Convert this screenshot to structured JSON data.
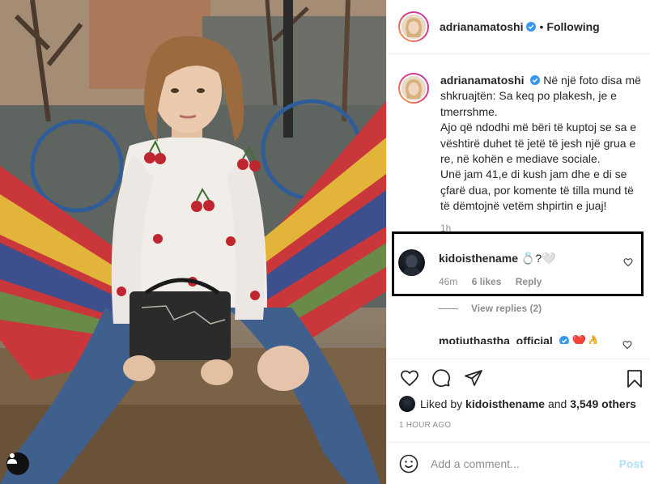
{
  "post": {
    "username": "adrianamatoshi",
    "separator": "•",
    "follow_status": "Following",
    "caption_text": "Në një foto disa më shkruajtën: Sa keq po plakesh, je e tmerrshme.\nAjo që ndodhi më bëri të kuptoj se sa e vështirë duhet të jetë të jesh një grua e re, në kohën e mediave sociale.\nUnë jam 41,e di kush jam dhe e di se çfarë dua, por komente të tilla mund të të dëmtojnë vetëm shpirtin e juaj!",
    "caption_age": "1h"
  },
  "comments": [
    {
      "username": "kidoisthename",
      "text": "💍?🤍",
      "age": "46m",
      "likes": "6 likes",
      "reply_label": "Reply"
    }
  ],
  "view_replies": "View replies (2)",
  "partial_comment": {
    "username": "motiuthastha_official",
    "text": "❤️👌"
  },
  "likes": {
    "prefix": "Liked by",
    "user": "kidoisthename",
    "middle": "and",
    "count": "3,549 others"
  },
  "timestamp": "1 HOUR AGO",
  "comment_input": {
    "placeholder": "Add a comment...",
    "post_label": "Post"
  },
  "icons": {
    "verified": "verified-badge-icon",
    "like": "heart-icon",
    "comment": "comment-bubble-icon",
    "share": "paper-plane-icon",
    "save": "bookmark-icon",
    "emoji": "smiley-icon",
    "user_tag": "person-icon"
  },
  "colors": {
    "verified": "#3897f0",
    "ring_start": "#f9b041",
    "ring_end": "#b63dba",
    "post_disabled": "#b2dffc",
    "highlight_box": "#000000"
  }
}
